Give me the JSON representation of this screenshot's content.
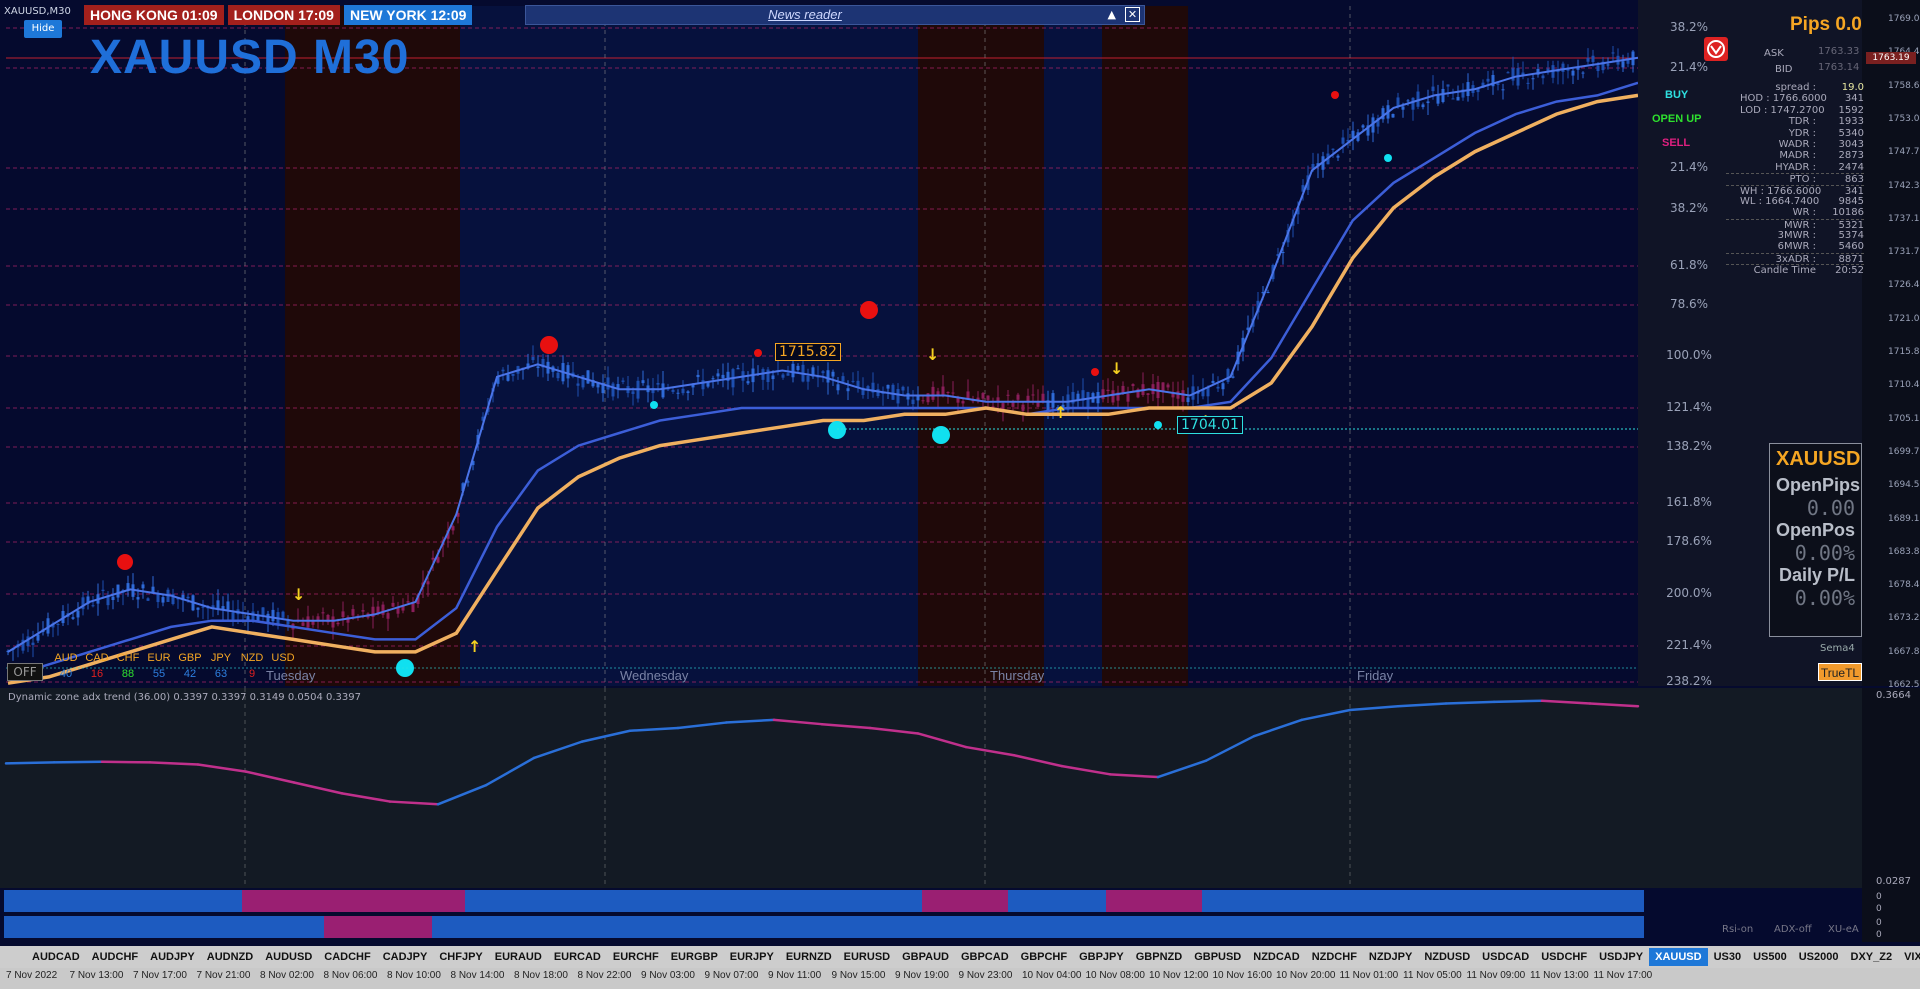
{
  "window": {
    "symbol_title": "XAUUSD,M30",
    "hide_label": "Hide",
    "big_title": "XAUUSD M30"
  },
  "clocks": [
    {
      "label": "HONG KONG 01:09",
      "color": "#a3201c"
    },
    {
      "label": "LONDON   17:09",
      "color": "#a3201c"
    },
    {
      "label": "NEW YORK 12:09",
      "color": "#1e78d8"
    }
  ],
  "news": {
    "title": "News reader",
    "up": "▲",
    "close": "✕"
  },
  "pips": "Pips 0.0",
  "ask_bid": {
    "ask_label": "ASK",
    "ask_value": "1763.33",
    "bid_label": "BID",
    "bid_value": "1763.14"
  },
  "stats": [
    {
      "k": "spread :",
      "v": "19.0",
      "c": "#e8e8a0"
    },
    {
      "k": "HOD :",
      "k2": "1766.6000",
      "v": "341"
    },
    {
      "k": "LOD :",
      "k2": "1747.2700",
      "v": "1592"
    },
    {
      "k": "TDR :",
      "v": "1933"
    },
    {
      "k": "YDR :",
      "v": "5340"
    },
    {
      "k": "WADR :",
      "v": "3043"
    },
    {
      "k": "MADR :",
      "v": "2873"
    },
    {
      "k": "HYADR :",
      "v": "2474"
    },
    {
      "k": "PTO :",
      "v": "863",
      "sep": true
    },
    {
      "k": "WH :",
      "k2": "1766.6000",
      "v": "341",
      "sep": true
    },
    {
      "k": "WL :",
      "k2": "1664.7400",
      "v": "9845"
    },
    {
      "k": "WR :",
      "v": "10186"
    },
    {
      "k": "MWR :",
      "v": "5321",
      "sep": true
    },
    {
      "k": "3MWR :",
      "v": "5374"
    },
    {
      "k": "6MWR :",
      "v": "5460"
    },
    {
      "k": "3xADR :",
      "v": "8871",
      "sep": true
    },
    {
      "k": "Candle Time",
      "v": "20:52",
      "sep": true
    }
  ],
  "signals": {
    "buy": "BUY",
    "open": "OPEN UP",
    "sell": "SELL"
  },
  "price_tag": "1763.19",
  "callouts": {
    "high": "1715.82",
    "low": "1704.01"
  },
  "fib_labels": [
    "38.2%",
    "21.4%",
    "21.4%",
    "38.2%",
    "61.8%",
    "78.6%",
    "100.0%",
    "121.4%",
    "138.2%",
    "161.8%",
    "178.6%",
    "200.0%",
    "221.4%",
    "238.2%"
  ],
  "y_axis": [
    "1769.05",
    "1764.46",
    "1758.60",
    "1753.00",
    "1747.75",
    "1742.35",
    "1737.10",
    "1731.70",
    "1726.45",
    "1721.05",
    "1715.80",
    "1710.40",
    "1705.15",
    "1699.75",
    "1694.50",
    "1689.10",
    "1683.85",
    "1678.45",
    "1673.20",
    "1667.80",
    "1662.55"
  ],
  "currencies": [
    {
      "name": "AUD",
      "val": "40",
      "c": "#2e7fe0"
    },
    {
      "name": "CAD",
      "val": "16",
      "c": "#e02020"
    },
    {
      "name": "CHF",
      "val": "88",
      "c": "#2ee02e"
    },
    {
      "name": "EUR",
      "val": "55",
      "c": "#2e7fe0"
    },
    {
      "name": "GBP",
      "val": "42",
      "c": "#2e7fe0"
    },
    {
      "name": "JPY",
      "val": "63",
      "c": "#2e7fe0"
    },
    {
      "name": "NZD",
      "val": "9",
      "c": "#e02020"
    },
    {
      "name": "USD",
      "val": "",
      "c": "#e02020"
    }
  ],
  "off_label": "OFF",
  "days": [
    "Tuesday",
    "Wednesday",
    "Thursday",
    "Friday"
  ],
  "infobox": {
    "title": "XAUUSD",
    "open_pips_label": "OpenPips",
    "open_pips": "0.00",
    "open_pos_label": "OpenPos",
    "open_pos": "0.00%",
    "daily_label": "Daily P/L",
    "daily": "0.00%"
  },
  "sema": "Sema4",
  "truetl": "TrueTL",
  "sub": {
    "title": "Dynamic zone adx trend (36.00) 0.3397 0.3397 0.3149 0.0504 0.3397",
    "ymax": "0.3664",
    "ymin": "0.0287"
  },
  "heat_axis": [
    "0",
    "0",
    "0",
    "0"
  ],
  "bottom_info": [
    "Rsi-on",
    "ADX-off",
    "XU-eA"
  ],
  "symbols": [
    "AUDCAD",
    "AUDCHF",
    "AUDJPY",
    "AUDNZD",
    "AUDUSD",
    "CADCHF",
    "CADJPY",
    "CHFJPY",
    "EURAUD",
    "EURCAD",
    "EURCHF",
    "EURGBP",
    "EURJPY",
    "EURNZD",
    "EURUSD",
    "GBPAUD",
    "GBPCAD",
    "GBPCHF",
    "GBPJPY",
    "GBPNZD",
    "GBPUSD",
    "NZDCAD",
    "NZDCHF",
    "NZDJPY",
    "NZDUSD",
    "USDCAD",
    "USDCHF",
    "USDJPY",
    "XAUUSD",
    "US30",
    "US500",
    "US2000",
    "DXY_Z2",
    "VIX_X2"
  ],
  "selected_symbol": "XAUUSD",
  "time_axis": [
    "7 Nov 2022",
    "7 Nov 13:00",
    "7 Nov 17:00",
    "7 Nov 21:00",
    "8 Nov 02:00",
    "8 Nov 06:00",
    "8 Nov 10:00",
    "8 Nov 14:00",
    "8 Nov 18:00",
    "8 Nov 22:00",
    "9 Nov 03:00",
    "9 Nov 07:00",
    "9 Nov 11:00",
    "9 Nov 15:00",
    "9 Nov 19:00",
    "9 Nov 23:00",
    "10 Nov 04:00",
    "10 Nov 08:00",
    "10 Nov 12:00",
    "10 Nov 16:00",
    "10 Nov 20:00",
    "11 Nov 01:00",
    "11 Nov 05:00",
    "11 Nov 09:00",
    "11 Nov 13:00",
    "11 Nov 17:00"
  ],
  "chart_data": {
    "type": "line",
    "title": "XAUUSD M30",
    "ylim": [
      1662.55,
      1769.05
    ],
    "series": [
      {
        "values": [
          1668,
          1672,
          1676,
          1678,
          1677,
          1675,
          1674,
          1673,
          1673,
          1674,
          1676,
          1690,
          1712,
          1714,
          1712,
          1710,
          1710,
          1711,
          1712,
          1713,
          1712,
          1710,
          1709,
          1709,
          1708,
          1708,
          1708,
          1709,
          1710,
          1709,
          1712,
          1728,
          1745,
          1750,
          1755,
          1757,
          1758,
          1760,
          1761,
          1762,
          1763
        ]
      },
      {
        "values": [
          1664,
          1666,
          1668,
          1670,
          1672,
          1673,
          1673,
          1672,
          1671,
          1670,
          1670,
          1675,
          1688,
          1697,
          1701,
          1703,
          1705,
          1706,
          1707,
          1707,
          1707,
          1707,
          1707,
          1707,
          1707,
          1706,
          1707,
          1707,
          1707,
          1707,
          1708,
          1715,
          1726,
          1737,
          1743,
          1747,
          1751,
          1754,
          1756,
          1757,
          1759
        ]
      },
      {
        "values": [
          1663,
          1664,
          1666,
          1668,
          1670,
          1672,
          1671,
          1670,
          1669,
          1668,
          1668,
          1671,
          1681,
          1691,
          1696,
          1699,
          1701,
          1702,
          1703,
          1704,
          1705,
          1705,
          1706,
          1706,
          1707,
          1706,
          1706,
          1706,
          1707,
          1707,
          1707,
          1711,
          1720,
          1731,
          1739,
          1744,
          1748,
          1751,
          1754,
          1756,
          1757
        ]
      }
    ]
  },
  "adx_data": {
    "type": "line",
    "ylim": [
      0.0287,
      0.3664
    ],
    "values": [
      0.25,
      0.252,
      0.253,
      0.252,
      0.248,
      0.235,
      0.215,
      0.195,
      0.18,
      0.175,
      0.21,
      0.26,
      0.29,
      0.31,
      0.315,
      0.325,
      0.33,
      0.322,
      0.315,
      0.305,
      0.28,
      0.265,
      0.245,
      0.23,
      0.225,
      0.255,
      0.3,
      0.33,
      0.348,
      0.355,
      0.36,
      0.363,
      0.365,
      0.36,
      0.355
    ]
  }
}
